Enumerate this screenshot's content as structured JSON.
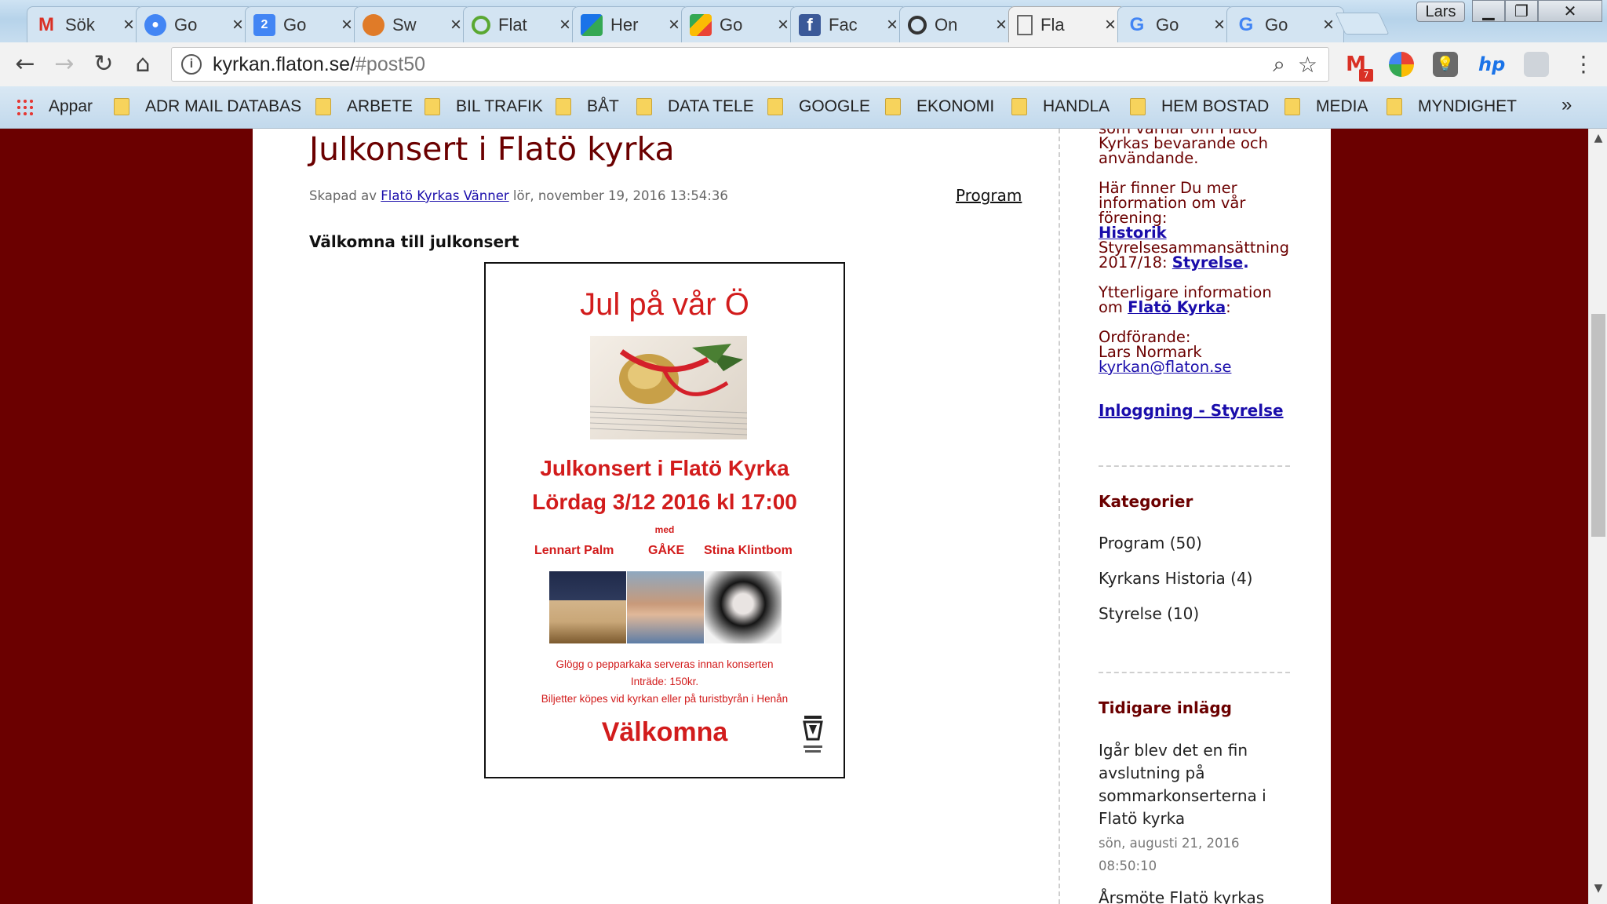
{
  "tabs": [
    {
      "title": "Sök",
      "icon": "gmail-icon"
    },
    {
      "title": "Go",
      "icon": "google-account-icon"
    },
    {
      "title": "Go",
      "icon": "google-calendar-icon",
      "badge": "2"
    },
    {
      "title": "Sw",
      "icon": "swedbank-icon"
    },
    {
      "title": "Flat",
      "icon": "flat-green-ring-icon"
    },
    {
      "title": "Her",
      "icon": "here-maps-icon"
    },
    {
      "title": "Go",
      "icon": "google-maps-icon"
    },
    {
      "title": "Fac",
      "icon": "facebook-icon"
    },
    {
      "title": "On",
      "icon": "ring-icon"
    },
    {
      "title": "Fla",
      "icon": "page-icon",
      "active": true
    },
    {
      "title": "Go",
      "icon": "google-icon"
    },
    {
      "title": "Go",
      "icon": "google-icon"
    }
  ],
  "window": {
    "profile": "Lars"
  },
  "omnibox": {
    "host": "kyrkan.flaton.se/",
    "path": "#post50"
  },
  "extensions": {
    "gmail_count": "7"
  },
  "bookmarks": {
    "apps": "Appar",
    "folders": [
      "ADR MAIL DATABAS",
      "ARBETE",
      "BIL TRAFIK",
      "BÅT",
      "DATA TELE",
      "GOOGLE",
      "EKONOMI",
      "HANDLA",
      "HEM BOSTAD",
      "MEDIA",
      "MYNDIGHET"
    ],
    "more": "»"
  },
  "post": {
    "title": "Julkonsert i Flatö kyrka",
    "meta_prefix": "Skapad av",
    "author": "Flatö Kyrkas Vänner",
    "date": "lör, november 19, 2016 13:54:36",
    "category": "Program",
    "intro": "Välkomna till julkonsert"
  },
  "poster": {
    "title": "Jul på vår Ö",
    "headline": "Julkonsert i Flatö Kyrka",
    "datetime": "Lördag 3/12 2016 kl 17:00",
    "med": "med",
    "artists": [
      "Lennart Palm",
      "GÅKE",
      "Stina Klintbom"
    ],
    "info": [
      "Glögg o pepparkaka serveras innan konserten",
      "Inträde: 150kr.",
      "Biljetter köpes vid kyrkan eller på turistbyrån i Henån"
    ],
    "welcome": "Välkomna"
  },
  "sidebar": {
    "top_lines": [
      "som värnar om Flatö",
      "Kyrkas bevarande och",
      "användande."
    ],
    "info_lines": [
      "Här finner Du mer",
      "information om vår",
      "förening:"
    ],
    "historik": "Historik",
    "board_text": "Styrelsesammansättning",
    "board_year": "2017/18: ",
    "board_link": "Styrelse",
    "board_period": ".",
    "more_lines": [
      "Ytterligare information"
    ],
    "more_prefix": "om ",
    "more_link": "Flatö Kyrka",
    "more_suffix": ":",
    "chair_label": "Ordförande:",
    "chair_name": "Lars Normark",
    "email": "kyrkan@flaton.se",
    "login": "Inloggning - Styrelse",
    "categories_heading": "Kategorier",
    "categories": [
      "Program (50)",
      "Kyrkans Historia (4)",
      "Styrelse (10)"
    ],
    "recent_heading": "Tidigare inlägg",
    "recent_title": "Igår blev det en fin avslutning på sommarkonserterna i Flatö kyrka",
    "recent_date_1": "sön, augusti 21, 2016",
    "recent_date_2": "08:50:10",
    "recent_next": "Årsmöte Flatö kyrkas"
  }
}
